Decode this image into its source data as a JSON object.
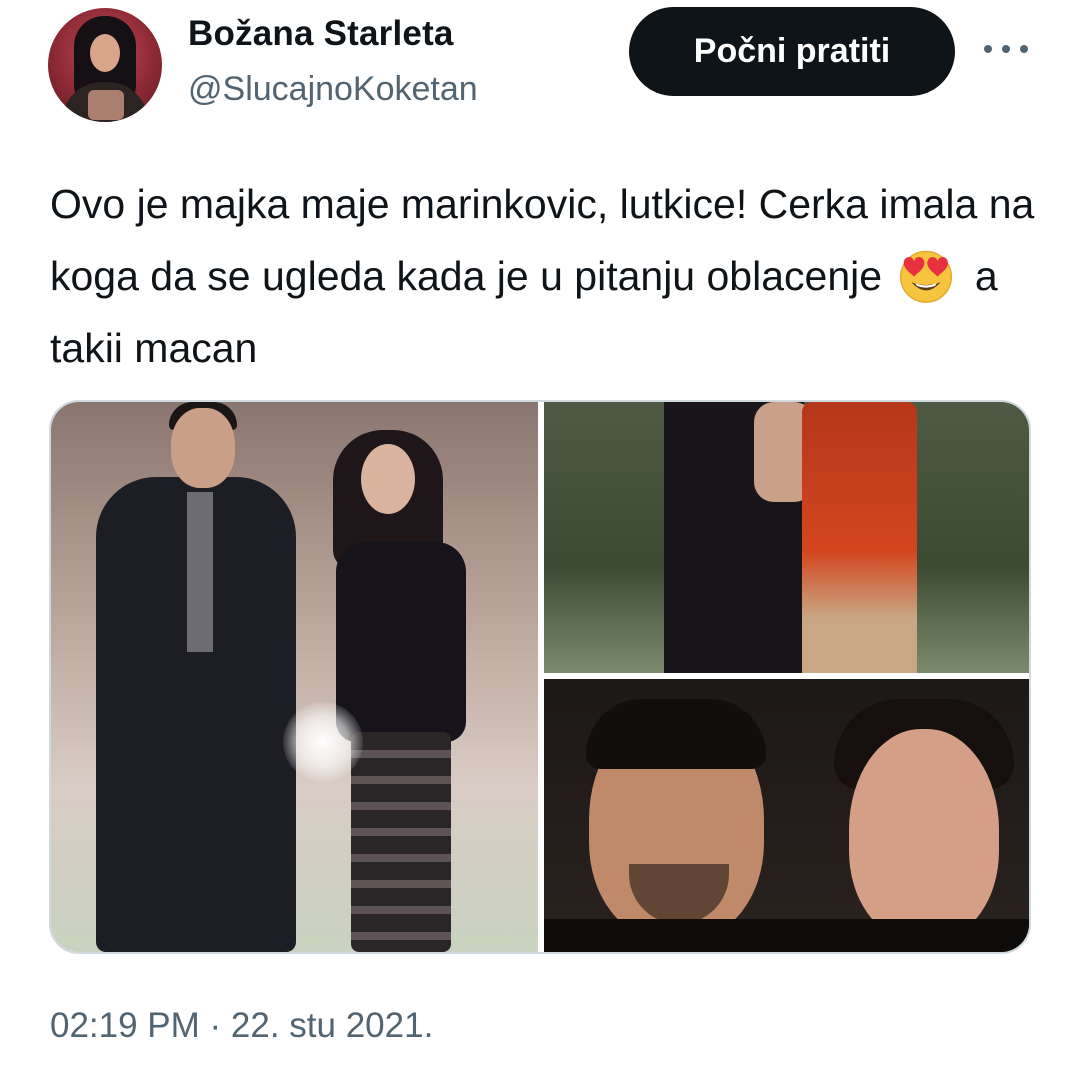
{
  "author": {
    "name": "Božana Starleta",
    "handle": "@SlucajnoKoketan"
  },
  "actions": {
    "follow_label": "Počni pratiti",
    "more_icon": "more-horizontal-icon"
  },
  "tweet": {
    "text_before_emoji": "Ovo je majka maje marinkovic, lutkice! Cerka imala na koga da se ugleda kada je u pitanju oblacenje",
    "emoji": "heart-eyes-emoji",
    "text_after_emoji": "a takii macan",
    "timestamp": "02:19 PM · 22. stu 2021."
  },
  "colors": {
    "text": "#0f1419",
    "secondary": "#536471",
    "button_bg": "#0f1419",
    "border": "#cfd9de"
  }
}
